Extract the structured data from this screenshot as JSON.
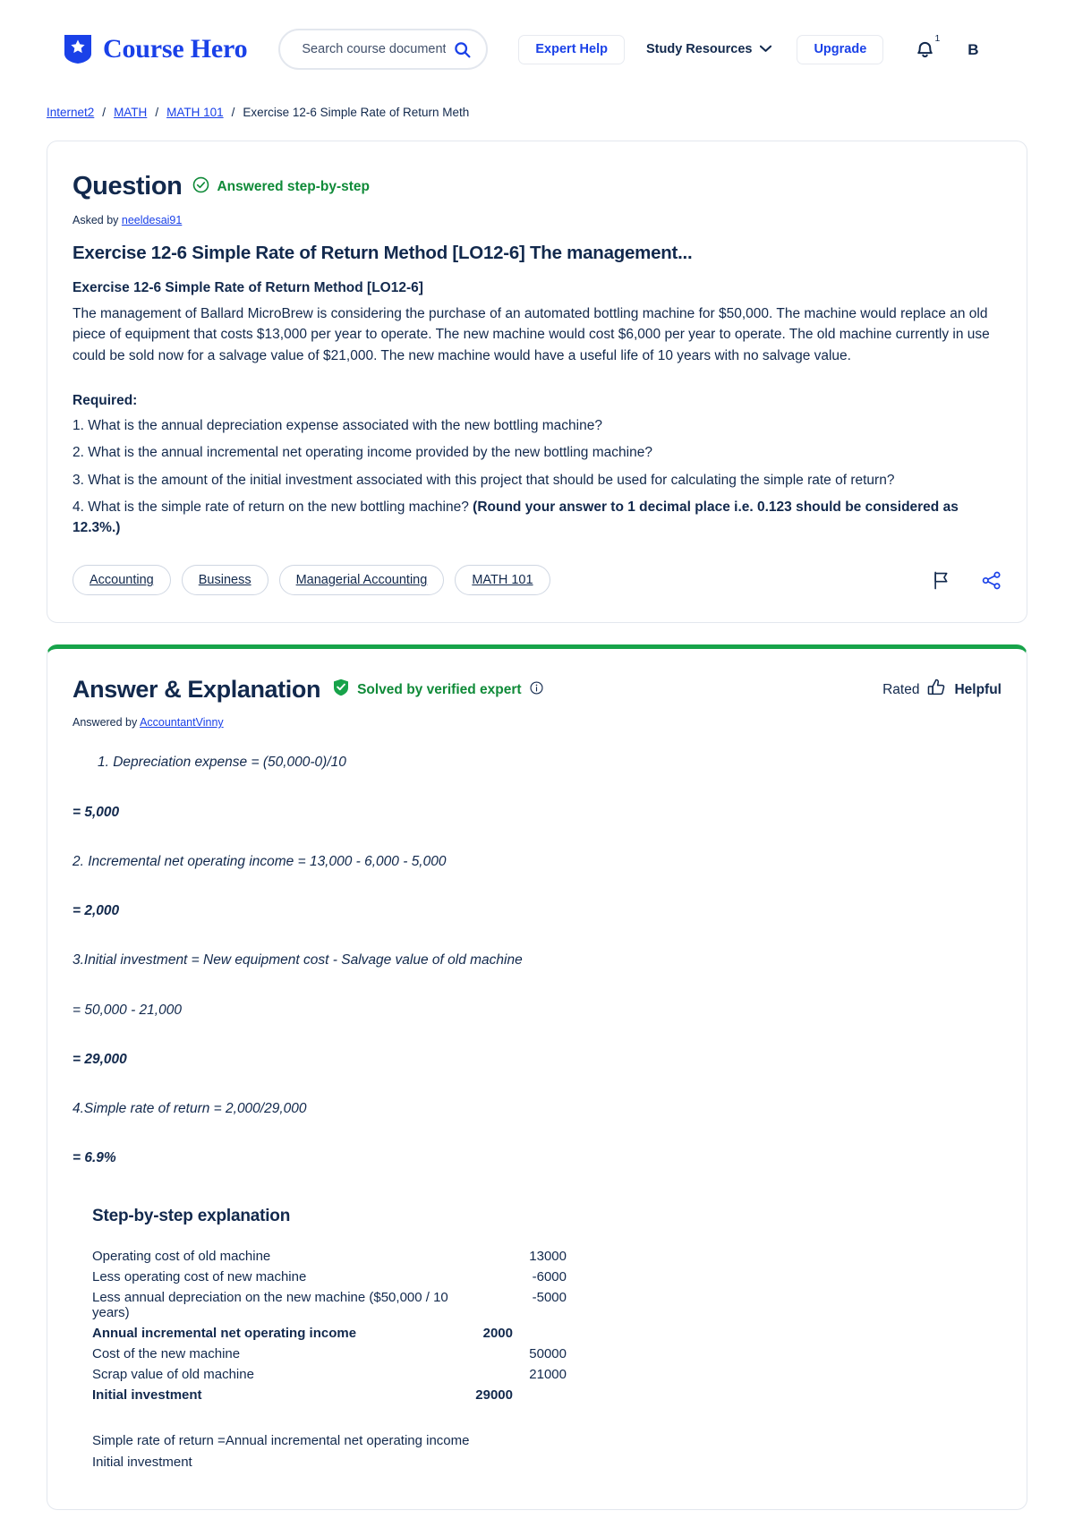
{
  "header": {
    "brand": "Course Hero",
    "brand_color": "#1a41e8",
    "search": {
      "placeholder": "Search course documents, ",
      "value": "",
      "icon": "search-icon"
    },
    "expert_help_label": "Expert Help",
    "study_resources_label": "Study Resources",
    "upgrade_label": "Upgrade",
    "notification_count": "1",
    "avatar_initial": "B"
  },
  "breadcrumb": {
    "items": [
      {
        "label": "Internet2",
        "link": true
      },
      {
        "label": "MATH",
        "link": true
      },
      {
        "label": "MATH 101",
        "link": true
      },
      {
        "label": "Exercise 12-6 Simple Rate of Return Meth",
        "link": false
      }
    ],
    "separator": "/"
  },
  "question": {
    "title": "Question",
    "status_label": "Answered step-by-step",
    "status_color": "#0f8a38",
    "asked_by_prefix": "Asked by",
    "asked_by_user": "neeldesai91",
    "heading": "Exercise 12-6 Simple Rate of Return Method [LO12-6] The management...",
    "subheading": "Exercise 12-6 Simple Rate of Return Method [LO12-6]",
    "body": "The management of Ballard MicroBrew is considering the purchase of an automated bottling machine for $50,000. The machine would replace an old piece of equipment that costs $13,000 per year to operate. The new machine would cost $6,000 per year to operate. The old machine currently in use could be sold now for a salvage value of $21,000. The new machine would have a useful life of 10 years with no salvage value.",
    "required_label": "Required:",
    "required_items": [
      {
        "text": "1. What is the annual depreciation expense associated with the new bottling machine?",
        "bold_tail": ""
      },
      {
        "text": "2. What is the annual incremental net operating income provided by the new bottling machine?",
        "bold_tail": ""
      },
      {
        "text": "3. What is the amount of the initial investment associated with this project that should be used for calculating the simple rate of return?",
        "bold_tail": ""
      },
      {
        "text": "4. What is the simple rate of return on the new bottling machine? ",
        "bold_tail": "(Round your answer to 1 decimal place i.e. 0.123 should be considered as 12.3%.)"
      }
    ],
    "tags": [
      "Accounting",
      "Business",
      "Managerial Accounting",
      "MATH 101"
    ],
    "flag_icon": "flag-icon",
    "share_icon": "share-icon"
  },
  "answer": {
    "title": "Answer & Explanation",
    "verified_label": "Solved by verified expert",
    "verified_color": "#0f8a38",
    "info_icon": "info-icon",
    "rated_label": "Rated",
    "helpful_label": "Helpful",
    "thumbs_up_icon": "thumbs-up-icon",
    "answered_by_prefix": "Answered by",
    "answered_by_user": "AccountantVinny",
    "lines": [
      {
        "text": "1. Depreciation expense = (50,000-0)/10",
        "bold": false,
        "indent": true
      },
      {
        "text": "= 5,000",
        "bold": true,
        "indent": false
      },
      {
        "text": "2. Incremental net operating income = 13,000 - 6,000 - 5,000",
        "bold": false,
        "indent": false
      },
      {
        "text": "= 2,000",
        "bold": true,
        "indent": false
      },
      {
        "text": "3.Initial investment = New equipment cost - Salvage value of old machine",
        "bold": false,
        "indent": false
      },
      {
        "text": "= 50,000 - 21,000",
        "bold": false,
        "indent": false
      },
      {
        "text": "= 29,000",
        "bold": true,
        "indent": false
      },
      {
        "text": "4.Simple rate of return = 2,000/29,000",
        "bold": false,
        "indent": false
      },
      {
        "text": "= 6.9%",
        "bold": true,
        "indent": false
      }
    ],
    "step_by_step": {
      "title": "Step-by-step explanation",
      "rows": [
        {
          "label": "Operating cost of old machine",
          "value": "13000",
          "bold": false
        },
        {
          "label": "Less operating cost of new machine",
          "value": "-6000",
          "bold": false
        },
        {
          "label": "Less annual depreciation on the new machine ($50,000 / 10 years)",
          "value": "-5000",
          "bold": false
        },
        {
          "label": "Annual incremental net operating income",
          "value": "2000",
          "bold": true
        },
        {
          "label": "Cost of the new machine",
          "value": "50000",
          "bold": false
        },
        {
          "label": "Scrap value of old machine",
          "value": "21000",
          "bold": false
        },
        {
          "label": "Initial investment",
          "value": "29000",
          "bold": true
        }
      ],
      "note_line_1": "Simple rate of return =Annual incremental net operating income",
      "note_line_2": "Initial investment"
    }
  }
}
